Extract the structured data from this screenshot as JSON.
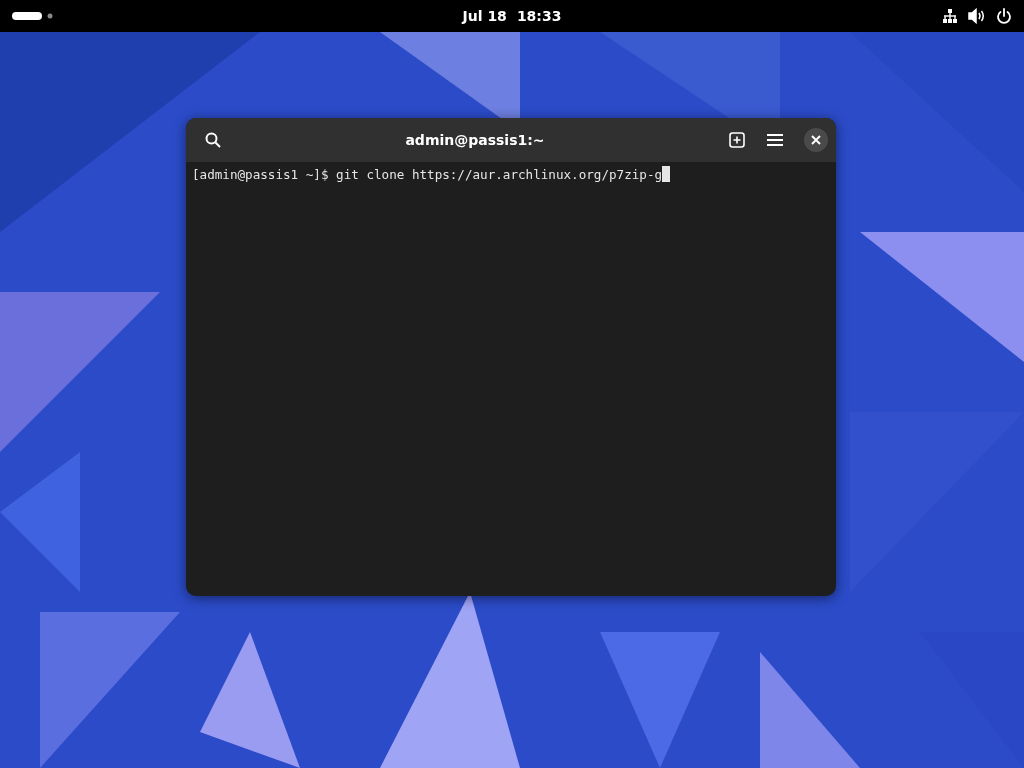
{
  "top_bar": {
    "date": "Jul 18",
    "time": "18:33"
  },
  "window": {
    "title": "admin@passis1:~",
    "terminal": {
      "lines": [
        "[admin@passis1 ~]$ git clone https://aur.archlinux.org/p7zip-g"
      ],
      "cursor": true
    }
  }
}
